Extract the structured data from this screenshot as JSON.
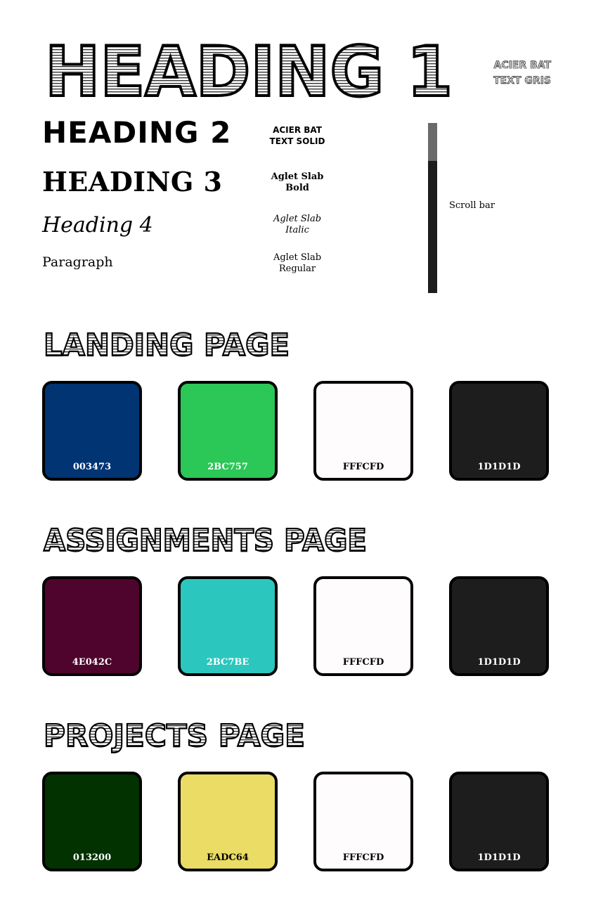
{
  "typography": {
    "heading1": "HEADING 1",
    "heading2": "HEADING 2",
    "heading3": "HEADING 3",
    "heading4": "Heading 4",
    "paragraph": "Paragraph",
    "font_gris_line1": "ACIER BAT",
    "font_gris_line2": "TEXT GRIS",
    "font_solid_line1": "ACIER BAT",
    "font_solid_line2": "TEXT SOLID",
    "font_bold_line1": "Aglet Slab",
    "font_bold_line2": "Bold",
    "font_italic_line1": "Aglet Slab",
    "font_italic_line2": "Italic",
    "font_regular_line1": "Aglet Slab",
    "font_regular_line2": "Regular"
  },
  "scrollbar": {
    "label": "Scroll bar"
  },
  "sections": [
    {
      "title": "LANDING PAGE",
      "swatches": [
        {
          "code": "003473",
          "color": "#003473",
          "text_color": "#ffffff"
        },
        {
          "code": "2BC757",
          "color": "#2BC757",
          "text_color": "#ffffff"
        },
        {
          "code": "FFFCFD",
          "color": "#FFFCFD",
          "text_color": "#000000"
        },
        {
          "code": "1D1D1D",
          "color": "#1D1D1D",
          "text_color": "#ffffff"
        }
      ]
    },
    {
      "title": "ASSIGNMENTS PAGE",
      "swatches": [
        {
          "code": "4E042C",
          "color": "#4E042C",
          "text_color": "#ffffff"
        },
        {
          "code": "2BC7BE",
          "color": "#2BC7BE",
          "text_color": "#ffffff"
        },
        {
          "code": "FFFCFD",
          "color": "#FFFCFD",
          "text_color": "#000000"
        },
        {
          "code": "1D1D1D",
          "color": "#1D1D1D",
          "text_color": "#ffffff"
        }
      ]
    },
    {
      "title": "PROJECTS PAGE",
      "swatches": [
        {
          "code": "013200",
          "color": "#013200",
          "text_color": "#ffffff"
        },
        {
          "code": "EADC64",
          "color": "#EADC64",
          "text_color": "#000000"
        },
        {
          "code": "FFFCFD",
          "color": "#FFFCFD",
          "text_color": "#000000"
        },
        {
          "code": "1D1D1D",
          "color": "#1D1D1D",
          "text_color": "#ffffff"
        }
      ]
    }
  ]
}
